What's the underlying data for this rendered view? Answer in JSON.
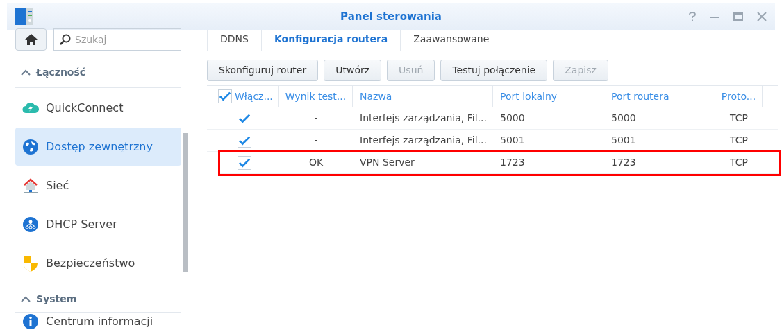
{
  "window": {
    "title": "Panel sterowania"
  },
  "sidebar": {
    "search": {
      "placeholder": "Szukaj"
    },
    "sections": [
      {
        "title": "Łączność",
        "expanded": true,
        "items": [
          {
            "label": "QuickConnect",
            "selected": false
          },
          {
            "label": "Dostęp zewnętrzny",
            "selected": true
          },
          {
            "label": "Sieć",
            "selected": false
          },
          {
            "label": "DHCP Server",
            "selected": false
          },
          {
            "label": "Bezpieczeństwo",
            "selected": false
          }
        ]
      },
      {
        "title": "System",
        "expanded": true,
        "items": [
          {
            "label": "Centrum informacji",
            "selected": false
          }
        ]
      }
    ]
  },
  "tabs": [
    {
      "label": "DDNS",
      "selected": false
    },
    {
      "label": "Konfiguracja routera",
      "selected": true
    },
    {
      "label": "Zaawansowane",
      "selected": false
    }
  ],
  "toolbar": [
    {
      "label": "Skonfiguruj router",
      "disabled": false
    },
    {
      "label": "Utwórz",
      "disabled": false
    },
    {
      "label": "Usuń",
      "disabled": true
    },
    {
      "label": "Testuj połączenie",
      "disabled": false
    },
    {
      "label": "Zapisz",
      "disabled": true
    }
  ],
  "table": {
    "all_checked": true,
    "columns": [
      "Włącz...",
      "Wynik test...",
      "Nazwa",
      "Port lokalny",
      "Port routera",
      "Proto..."
    ],
    "rows": [
      {
        "checked": true,
        "result": "-",
        "name": "Interfejs zarządzania, Fil...",
        "local_port": "5000",
        "router_port": "5000",
        "protocol": "TCP",
        "highlighted": false
      },
      {
        "checked": true,
        "result": "-",
        "name": "Interfejs zarządzania, Fil...",
        "local_port": "5001",
        "router_port": "5001",
        "protocol": "TCP",
        "highlighted": false
      },
      {
        "checked": true,
        "result": "OK",
        "name": "VPN Server",
        "local_port": "1723",
        "router_port": "1723",
        "protocol": "TCP",
        "highlighted": true
      }
    ]
  }
}
